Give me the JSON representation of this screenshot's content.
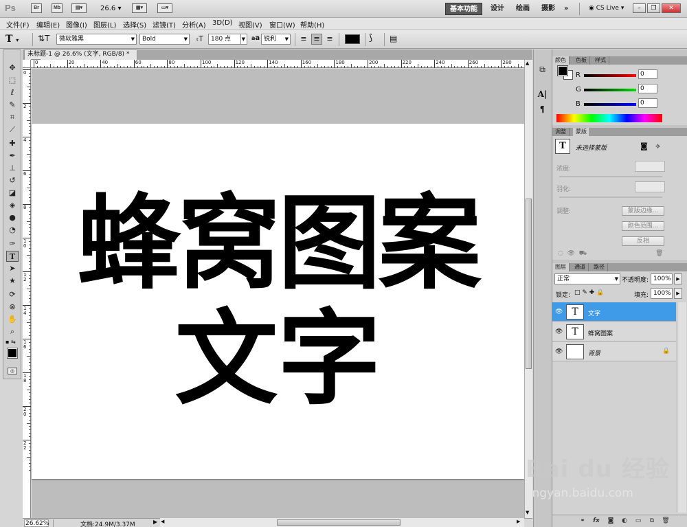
{
  "appbar": {
    "logo": "Ps",
    "icons": [
      "Br",
      "Mb"
    ],
    "zoom": "26.6",
    "workspaces": [
      "基本功能",
      "设计",
      "绘画",
      "摄影"
    ],
    "more": "»",
    "cslive": "CS Live"
  },
  "menu": [
    "文件(F)",
    "编辑(E)",
    "图像(I)",
    "图层(L)",
    "选择(S)",
    "滤镜(T)",
    "分析(A)",
    "3D(D)",
    "视图(V)",
    "窗口(W)",
    "帮助(H)"
  ],
  "options": {
    "font_family": "微软雅黑",
    "font_style": "Bold",
    "font_size": "180 点",
    "aa_label": "a",
    "antialias": "锐利",
    "text_color": "#000000"
  },
  "document": {
    "tab_title": "未标题-1 @ 26.6% (文字, RGB/8) *",
    "line1": "蜂窝图案",
    "line2": "文字",
    "ruler_h": [
      "0",
      "20",
      "40",
      "60",
      "80",
      "100",
      "120",
      "140",
      "160",
      "180",
      "200",
      "220",
      "240",
      "260",
      "280"
    ],
    "ruler_v": [
      "0",
      "2",
      "4",
      "6",
      "8",
      "10",
      "12",
      "14",
      "16",
      "18",
      "20",
      "22"
    ]
  },
  "status": {
    "zoom": "26.62%",
    "doc_info": "文档:24.9M/3.37M"
  },
  "color_panel": {
    "tabs": [
      "颜色",
      "色板",
      "样式"
    ],
    "channels": [
      {
        "label": "R",
        "value": "0"
      },
      {
        "label": "G",
        "value": "0"
      },
      {
        "label": "B",
        "value": "0"
      }
    ]
  },
  "mask_panel": {
    "tabs": [
      "调整",
      "蒙版"
    ],
    "title": "未选择蒙版",
    "density_label": "浓度:",
    "feather_label": "羽化:",
    "adjust_label": "调整:",
    "buttons": [
      "蒙版边缘...",
      "颜色范围...",
      "反相"
    ]
  },
  "layers_panel": {
    "tabs": [
      "图层",
      "通道",
      "路径"
    ],
    "blend_mode": "正常",
    "opacity_label": "不透明度:",
    "opacity": "100%",
    "lock_label": "锁定:",
    "fill_label": "填充:",
    "fill": "100%",
    "layers": [
      {
        "name": "文字",
        "thumb": "T",
        "selected": true
      },
      {
        "name": "蜂窝图案",
        "thumb": "T",
        "selected": false
      },
      {
        "name": "背景",
        "thumb": "",
        "selected": false
      }
    ],
    "bottom_icons": [
      "link-icon",
      "fx-icon",
      "mask-icon",
      "adjust-icon",
      "group-icon",
      "new-layer-icon",
      "trash-icon"
    ]
  },
  "watermark": {
    "brand": "Bai du 经验",
    "url": "jingyan.baidu.com"
  }
}
